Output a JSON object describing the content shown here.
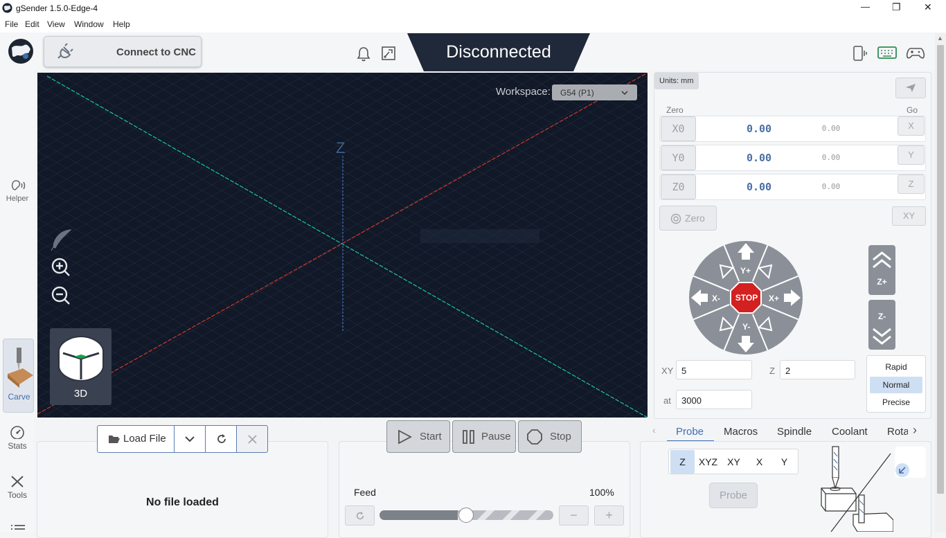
{
  "window": {
    "title": "gSender 1.5.0-Edge-4",
    "minimize": "—",
    "restore": "❐",
    "close": "✕"
  },
  "menu": [
    "File",
    "Edit",
    "View",
    "Window",
    "Help"
  ],
  "header": {
    "connect_label": "Connect to CNC",
    "status": "Disconnected"
  },
  "sidebar": {
    "helper": "Helper",
    "carve": "Carve",
    "stats": "Stats",
    "tools": "Tools"
  },
  "viewport": {
    "workspace_label": "Workspace:",
    "workspace_value": "G54 (P1)",
    "z_axis_label": "Z",
    "view_mode": "3D"
  },
  "dro": {
    "units": "Units: mm",
    "zero_header": "Zero",
    "go_header": "Go",
    "axes": [
      {
        "zero": "X0",
        "mpos": "0.00",
        "wpos": "0.00",
        "go": "X"
      },
      {
        "zero": "Y0",
        "mpos": "0.00",
        "wpos": "0.00",
        "go": "Y"
      },
      {
        "zero": "Z0",
        "mpos": "0.00",
        "wpos": "0.00",
        "go": "Z"
      }
    ],
    "zero_all": "Zero",
    "go_xy": "XY"
  },
  "jog": {
    "y_plus": "Y+",
    "y_minus": "Y-",
    "x_plus": "X+",
    "x_minus": "X-",
    "stop": "STOP",
    "z_plus": "Z+",
    "z_minus": "Z-",
    "xy_label": "XY",
    "xy_value": "5",
    "z_label": "Z",
    "z_value": "2",
    "at_label": "at",
    "at_value": "3000",
    "speeds": [
      "Rapid",
      "Normal",
      "Precise"
    ],
    "selected_speed": "Normal"
  },
  "file": {
    "load_label": "Load File",
    "status": "No file loaded"
  },
  "job": {
    "start": "Start",
    "pause": "Pause",
    "stop": "Stop",
    "feed_label": "Feed",
    "feed_value": "100%",
    "feed_level": 0.45
  },
  "tools_tabs": [
    "Probe",
    "Macros",
    "Spindle",
    "Coolant",
    "Rota"
  ],
  "active_tab": "Probe",
  "probe": {
    "types": [
      "Z",
      "XYZ",
      "XY",
      "X",
      "Y"
    ],
    "selected": "Z",
    "button": "Probe"
  },
  "colors": {
    "accent": "#3e6fb0",
    "stop_red": "#d32020",
    "viewport_bg": "#111827",
    "x_axis": "#c0392b",
    "y_axis": "#1abc9c"
  }
}
